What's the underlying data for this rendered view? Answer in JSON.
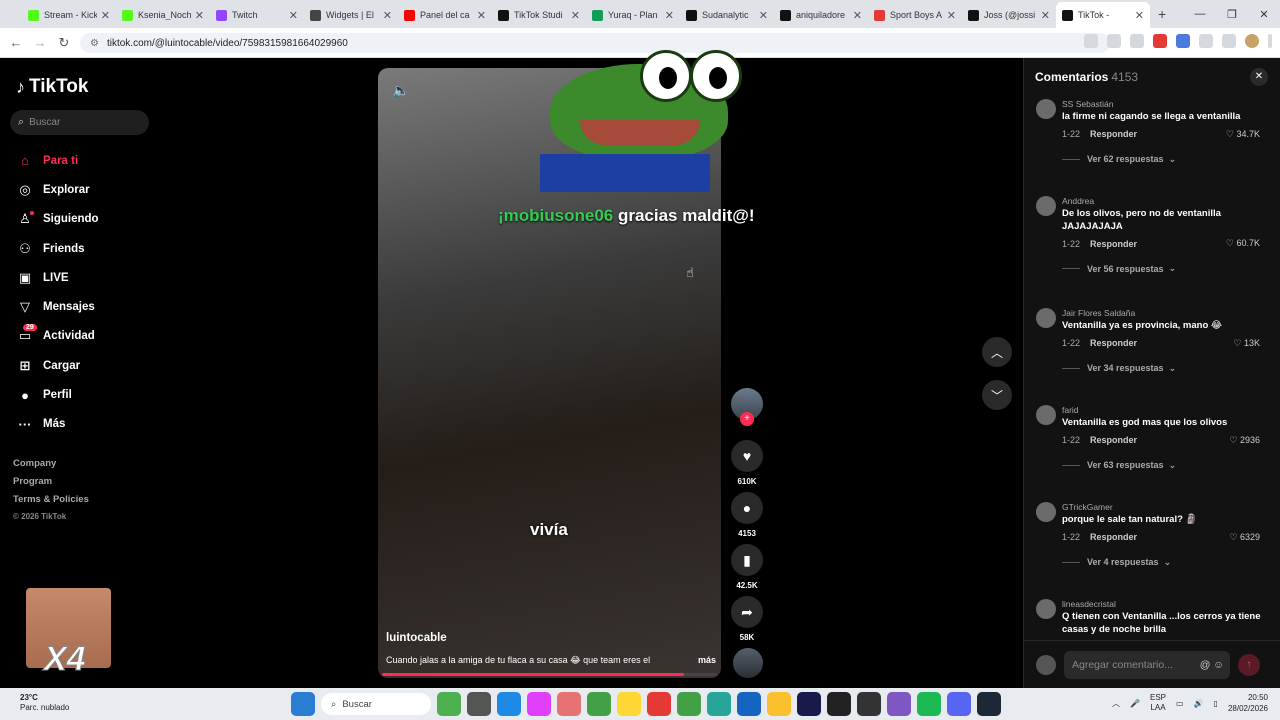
{
  "browser": {
    "tabs": [
      {
        "label": "Stream - Kick",
        "color": "#53fc18",
        "active": false
      },
      {
        "label": "Ksenia_Noch",
        "color": "#53fc18",
        "active": false
      },
      {
        "label": "Twitch",
        "color": "#9146ff",
        "active": false
      },
      {
        "label": "Widgets | El",
        "color": "#444444",
        "active": false
      },
      {
        "label": "Panel del ca",
        "color": "#ff0000",
        "active": false
      },
      {
        "label": "TikTok Studi",
        "color": "#111111",
        "active": false
      },
      {
        "label": "Yuraq - Plan",
        "color": "#0f9d58",
        "active": false
      },
      {
        "label": "Sudanalytic",
        "color": "#111111",
        "active": false
      },
      {
        "label": "aniquiladore",
        "color": "#111111",
        "active": false
      },
      {
        "label": "Sport Boys A",
        "color": "#e53935",
        "active": false
      },
      {
        "label": "Joss (@jossi",
        "color": "#111111",
        "active": false
      },
      {
        "label": "TikTok -",
        "color": "#111111",
        "active": true
      }
    ],
    "url": "tiktok.com/@luintocable/video/7598315981664029960"
  },
  "sidebar": {
    "logo": "TikTok",
    "search_placeholder": "Buscar",
    "items": [
      {
        "label": "Para ti",
        "icon": "home-icon",
        "glyph": "⌂"
      },
      {
        "label": "Explorar",
        "icon": "compass-icon",
        "glyph": "◎"
      },
      {
        "label": "Siguiendo",
        "icon": "following-icon",
        "glyph": "♙"
      },
      {
        "label": "Friends",
        "icon": "friends-icon",
        "glyph": "⚇"
      },
      {
        "label": "LIVE",
        "icon": "live-icon",
        "glyph": "▣"
      },
      {
        "label": "Mensajes",
        "icon": "messages-icon",
        "glyph": "▽"
      },
      {
        "label": "Actividad",
        "icon": "activity-icon",
        "glyph": "▭",
        "badge": "29"
      },
      {
        "label": "Cargar",
        "icon": "upload-icon",
        "glyph": "⊞"
      },
      {
        "label": "Perfil",
        "icon": "profile-icon",
        "glyph": "●"
      },
      {
        "label": "Más",
        "icon": "more-icon",
        "glyph": "···"
      }
    ],
    "footer": [
      "Company",
      "Program",
      "Terms & Policies",
      "© 2026 TikTok"
    ],
    "overlay_text": "X4"
  },
  "video": {
    "donation_name": "¡mobiusone06",
    "donation_text": " gracias maldit@!",
    "caption_word": "vivía",
    "username": "luintocable",
    "description": "Cuando jalas a la amiga de tu flaca a su casa 😂 que team eres el",
    "more": "más",
    "progress": 0.9,
    "actions": {
      "likes": "610K",
      "comments": "4153",
      "saves": "42.5K",
      "shares": "58K"
    }
  },
  "comments": {
    "title": "Comentarios",
    "count": "4153",
    "items": [
      {
        "user": "SS Sebastián",
        "text": "la firme ni cagando se llega a ventanilla",
        "date": "1-22",
        "reply": "Responder",
        "likes": "34.7K",
        "replies": "Ver 62 respuestas"
      },
      {
        "user": "Anddrea",
        "text": "De los olivos, pero no de ventanilla JAJAJAJAJA",
        "date": "1-22",
        "reply": "Responder",
        "likes": "60.7K",
        "replies": "Ver 56 respuestas"
      },
      {
        "user": "Jair Flores Saldaña",
        "text": "Ventanilla ya es provincia, mano 😂",
        "date": "1-22",
        "reply": "Responder",
        "likes": "13K",
        "replies": "Ver 34 respuestas"
      },
      {
        "user": "farid",
        "text": "Ventanilla es god mas que los olivos",
        "date": "1-22",
        "reply": "Responder",
        "likes": "2936",
        "replies": "Ver 63 respuestas"
      },
      {
        "user": "GTrickGamer",
        "text": "porque le sale tan natural? 🗿",
        "date": "1-22",
        "reply": "Responder",
        "likes": "6329",
        "replies": "Ver 4 respuestas"
      },
      {
        "user": "lineasdecristal",
        "text": "Q tienen con Ventanilla ...los cerros ya tiene casas y de noche brilla",
        "date": "",
        "reply": "",
        "likes": "",
        "replies": ""
      }
    ],
    "input_placeholder": "Agregar comentario..."
  },
  "taskbar": {
    "temp": "23°C",
    "weather": "Parc. nublado",
    "search": "Buscar",
    "lang1": "ESP",
    "lang2": "LAA",
    "time": "20:50",
    "date": "28/02/2026"
  }
}
